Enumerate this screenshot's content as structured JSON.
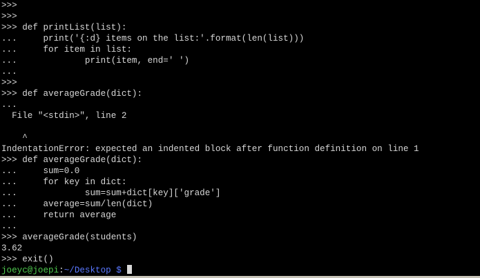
{
  "terminal": {
    "lines": [
      ">>>",
      ">>>",
      ">>> def printList(list):",
      "...     print('{:d} items on the list:'.format(len(list)))",
      "...     for item in list:",
      "...             print(item, end=' ')",
      "...",
      ">>>",
      ">>> def averageGrade(dict):",
      "...",
      "  File \"<stdin>\", line 2",
      "",
      "    ^",
      "IndentationError: expected an indented block after function definition on line 1",
      ">>> def averageGrade(dict):",
      "...     sum=0.0",
      "...     for key in dict:",
      "...             sum=sum+dict[key]['grade']",
      "...     average=sum/len(dict)",
      "...     return average",
      "...",
      ">>> averageGrade(students)",
      "3.62",
      ">>> exit()"
    ],
    "prompt": {
      "user_host": "joeyc@joepi",
      "separator": ":",
      "path": "~/Desktop",
      "symbol": "$"
    }
  },
  "colors": {
    "background": "#000000",
    "text": "#d8d8d8",
    "user_host": "#4ec94e",
    "path": "#5a78ff"
  }
}
